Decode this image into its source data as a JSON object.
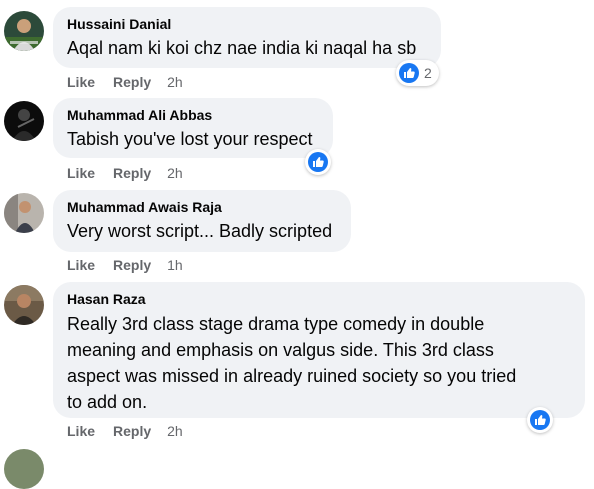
{
  "colors": {
    "accent": "#1877f2",
    "bubble": "#f0f2f5",
    "meta": "#65676b"
  },
  "comments": [
    {
      "author": "Hussaini Danial",
      "lines": [
        "Aqal nam ki koi chz nae india ki naqal ha sb"
      ],
      "like": "Like",
      "reply": "Reply",
      "time": "2h",
      "reactions": "2"
    },
    {
      "author": "Muhammad Ali Abbas",
      "lines": [
        "Tabish you've lost your respect"
      ],
      "like": "Like",
      "reply": "Reply",
      "time": "2h",
      "reactions": ""
    },
    {
      "author": "Muhammad Awais Raja",
      "lines": [
        "Very worst script... Badly scripted"
      ],
      "like": "Like",
      "reply": "Reply",
      "time": "1h",
      "reactions": ""
    },
    {
      "author": "Hasan Raza",
      "lines": [
        "Really 3rd class stage drama type comedy in double",
        "meaning and emphasis on valgus side. This 3rd class",
        "aspect was missed in already ruined society so you tried",
        "to add on."
      ],
      "like": "Like",
      "reply": "Reply",
      "time": "2h",
      "reactions": ""
    }
  ]
}
